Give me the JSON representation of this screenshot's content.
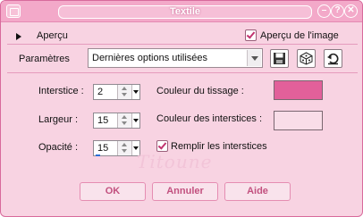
{
  "window": {
    "title": "Textile",
    "minimize_glyph": "–",
    "help_glyph": "?",
    "close_glyph": "✕"
  },
  "preview": {
    "label": "Aperçu",
    "preview_image_label": "Aperçu de l'image",
    "preview_image_checked": true
  },
  "presets": {
    "label": "Paramètres",
    "selected": "Dernières options utilisées"
  },
  "toolbar_icons": [
    "save-icon",
    "random-dice-icon",
    "reset-icon"
  ],
  "fields": {
    "interstice": {
      "label": "Interstice :",
      "value": "2"
    },
    "largeur": {
      "label": "Largeur :",
      "value": "15"
    },
    "opacite": {
      "label": "Opacité :",
      "value": "15"
    },
    "couleur_tissage": {
      "label": "Couleur du tissage :",
      "color": "#e2609a"
    },
    "couleur_interstices": {
      "label": "Couleur des interstices :",
      "color": "#f9dde8"
    },
    "remplir": {
      "label": "Remplir les interstices",
      "checked": true
    }
  },
  "buttons": {
    "ok": "OK",
    "annuler": "Annuler",
    "aide": "Aide"
  },
  "colors": {
    "window_bg": "#f8d3e2",
    "titlebar": "#f3a9c9",
    "accent": "#c2517f"
  },
  "watermark": "Titoune"
}
